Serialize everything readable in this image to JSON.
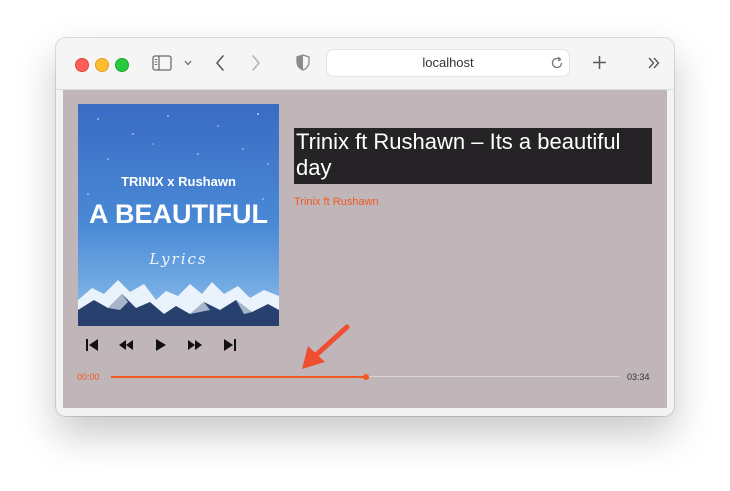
{
  "browser": {
    "url": "localhost",
    "icons": [
      "sidebar-icon",
      "chevron-down-icon",
      "back-icon",
      "forward-icon",
      "shield-icon",
      "reload-icon",
      "new-tab-icon",
      "overflow-icon"
    ]
  },
  "album_art": {
    "line1": "TRINIX x Rushawn",
    "line2": "A BEAUTIFUL",
    "line3": "Lyrics"
  },
  "track": {
    "title": "Trinix ft Rushawn – Its a beautiful day",
    "artist": "Trinix ft Rushawn"
  },
  "controls": [
    "skip-previous-icon",
    "rewind-icon",
    "play-icon",
    "fast-forward-icon",
    "skip-next-icon"
  ],
  "progress": {
    "current": "00:00",
    "duration": "03:34",
    "fraction": 0.5
  },
  "colors": {
    "accent": "#f15a22",
    "content_bg": "#c0b5b9",
    "title_bg": "#252325",
    "annotation_arrow": "#f04e30"
  }
}
